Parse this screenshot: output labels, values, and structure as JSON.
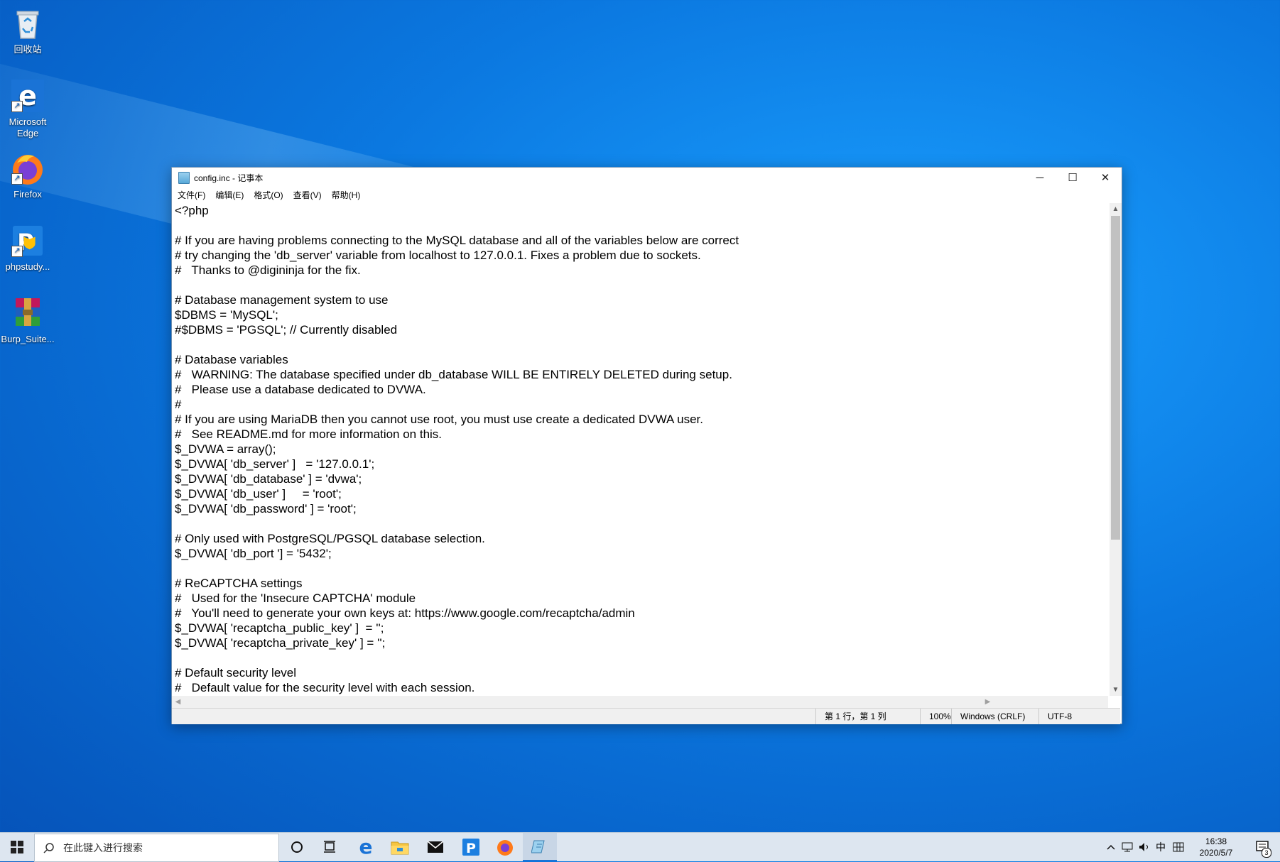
{
  "desktop": {
    "icons": [
      {
        "label": "回收站",
        "icon": "recycle-bin-icon"
      },
      {
        "label": "Microsoft Edge",
        "icon": "edge-icon"
      },
      {
        "label": "Firefox",
        "icon": "firefox-icon"
      },
      {
        "label": "phpstudy...",
        "icon": "phpstudy-icon"
      },
      {
        "label": "Burp_Suite...",
        "icon": "winrar-icon"
      }
    ]
  },
  "window": {
    "title": "config.inc - 记事本",
    "controls": {
      "minimize": "─",
      "maximize": "☐",
      "close": "✕"
    },
    "menu": [
      "文件(F)",
      "编辑(E)",
      "格式(O)",
      "查看(V)",
      "帮助(H)"
    ],
    "content": "<?php\n\n# If you are having problems connecting to the MySQL database and all of the variables below are correct\n# try changing the 'db_server' variable from localhost to 127.0.0.1. Fixes a problem due to sockets.\n#   Thanks to @digininja for the fix.\n\n# Database management system to use\n$DBMS = 'MySQL';\n#$DBMS = 'PGSQL'; // Currently disabled\n\n# Database variables\n#   WARNING: The database specified under db_database WILL BE ENTIRELY DELETED during setup.\n#   Please use a database dedicated to DVWA.\n#\n# If you are using MariaDB then you cannot use root, you must use create a dedicated DVWA user.\n#   See README.md for more information on this.\n$_DVWA = array();\n$_DVWA[ 'db_server' ]   = '127.0.0.1';\n$_DVWA[ 'db_database' ] = 'dvwa';\n$_DVWA[ 'db_user' ]     = 'root';\n$_DVWA[ 'db_password' ] = 'root';\n\n# Only used with PostgreSQL/PGSQL database selection.\n$_DVWA[ 'db_port '] = '5432';\n\n# ReCAPTCHA settings\n#   Used for the 'Insecure CAPTCHA' module\n#   You'll need to generate your own keys at: https://www.google.com/recaptcha/admin\n$_DVWA[ 'recaptcha_public_key' ]  = '';\n$_DVWA[ 'recaptcha_private_key' ] = '';\n\n# Default security level\n#   Default value for the security level with each session.",
    "status": {
      "position": "第 1 行，第 1 列",
      "zoom": "100%",
      "line_ending": "Windows (CRLF)",
      "encoding": "UTF-8"
    }
  },
  "taskbar": {
    "search_placeholder": "在此键入进行搜索",
    "apps": [
      "cortana-icon",
      "task-view-icon",
      "edge-icon",
      "file-explorer-icon",
      "mail-icon",
      "phpstudy-icon",
      "firefox-icon",
      "notepad-icon"
    ],
    "tray": {
      "ime": "中",
      "time": "16:38",
      "date": "2020/5/7",
      "notification_count": "3"
    }
  }
}
